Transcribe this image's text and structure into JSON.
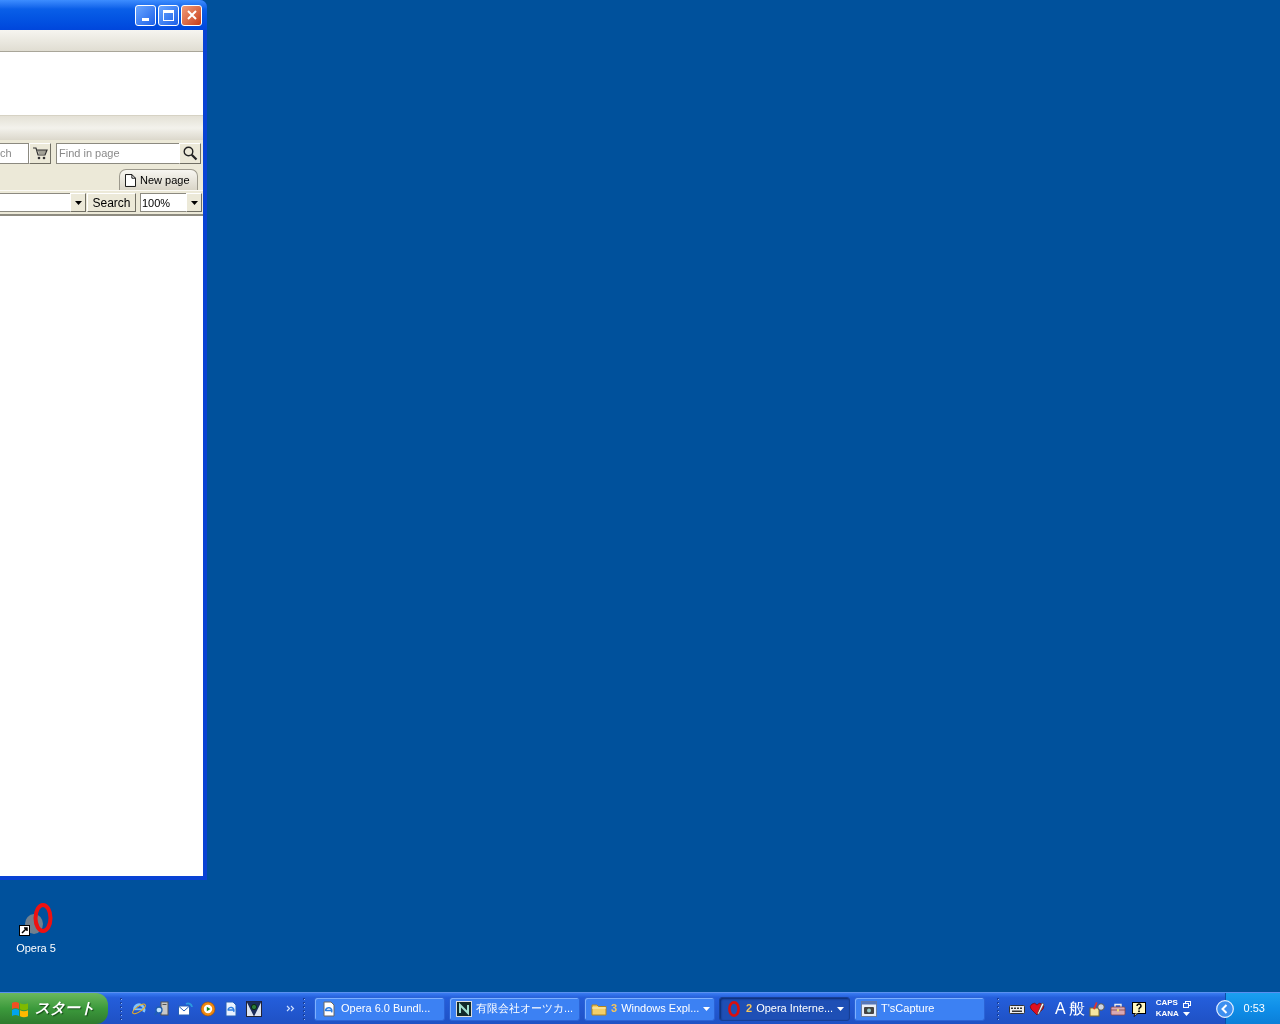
{
  "browser_window": {
    "search_field": {
      "placeholder": "ch"
    },
    "find_field": {
      "placeholder": "Find in page"
    },
    "new_page_tab": {
      "label": "New page"
    },
    "search_button": {
      "label": "Search"
    },
    "zoom_field": {
      "value": "100%"
    }
  },
  "desktop_icons": [
    {
      "label": "Opera 5"
    }
  ],
  "taskbar": {
    "start_button": {
      "label": "スタート"
    },
    "task_buttons": [
      {
        "kind": "single",
        "label": "Opera 6.0 Bundl...",
        "selected": false
      },
      {
        "kind": "single",
        "label": "有限会社オーツカ...",
        "selected": false
      },
      {
        "kind": "group",
        "count": "3",
        "label": "Windows Expl...",
        "selected": false
      },
      {
        "kind": "group",
        "count": "2",
        "label": "Opera Interne...",
        "selected": true
      },
      {
        "kind": "single",
        "label": "T'sCapture",
        "selected": false
      }
    ],
    "language_bar": {
      "input_mode": "A",
      "conversion_mode": "般",
      "lock_keys": [
        "CAPS",
        "KANA"
      ]
    },
    "clock": "0:53"
  }
}
